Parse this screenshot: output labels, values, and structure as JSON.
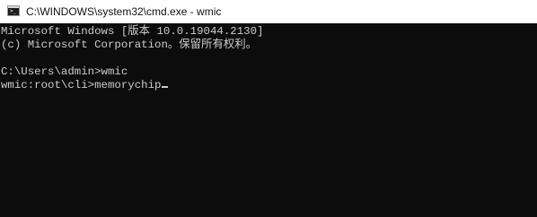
{
  "window": {
    "title": "C:\\WINDOWS\\system32\\cmd.exe - wmic",
    "icon": "cmd-app-icon"
  },
  "console": {
    "lines": [
      "Microsoft Windows [版本 10.0.19044.2130]",
      "(c) Microsoft Corporation。保留所有权利。",
      "",
      "C:\\Users\\admin>wmic",
      "wmic:root\\cli>memorychip"
    ],
    "background_color": "#0c0c0c",
    "text_color": "#cccccc"
  }
}
